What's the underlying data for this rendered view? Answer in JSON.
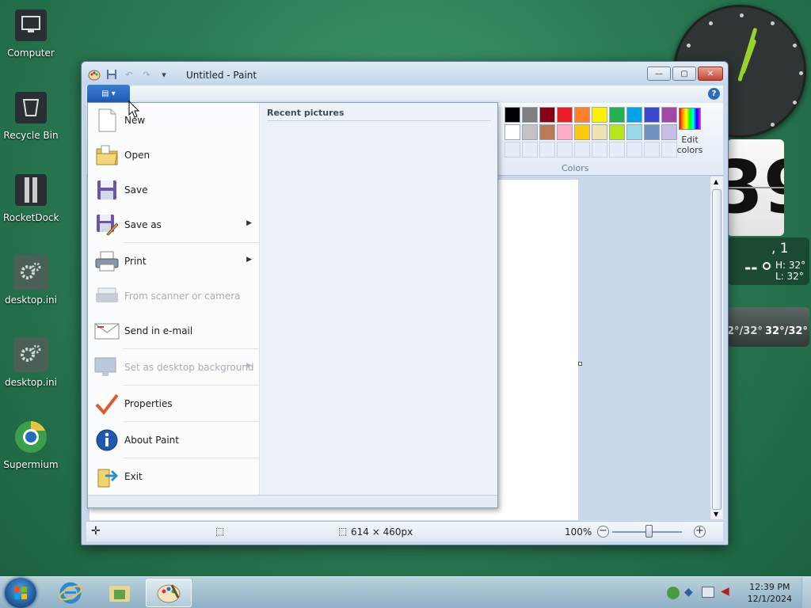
{
  "desktop": {
    "icons": [
      {
        "label": "Computer",
        "icon": "computer-icon"
      },
      {
        "label": "Recycle Bin",
        "icon": "recycle-bin-icon"
      },
      {
        "label": "RocketDock",
        "icon": "rocketdock-icon"
      },
      {
        "label": "desktop.ini",
        "icon": "settings-file-icon"
      },
      {
        "label": "desktop.ini",
        "icon": "settings-file-icon"
      },
      {
        "label": "Supermium",
        "icon": "browser-icon"
      }
    ]
  },
  "gadgets": {
    "flip_clock_digit": "39",
    "weather": {
      "top": ", 1",
      "temp": "--",
      "high": "H: 32°",
      "low": "L: 32°"
    },
    "forecast": {
      "left": "2°/32°",
      "right": "32°/32°"
    }
  },
  "window": {
    "title": "Untitled - Paint",
    "help_label": "?",
    "caption_buttons": {
      "minimize": "—",
      "maximize": "▢",
      "close": "✕"
    }
  },
  "ribbon": {
    "palette": {
      "row1": [
        "#000000",
        "#7f7f7f",
        "#880015",
        "#ed1c24",
        "#ff7f27",
        "#fff200",
        "#22b14c",
        "#00a2e8",
        "#3f48cc",
        "#a349a4"
      ],
      "row2": [
        "#ffffff",
        "#c3c3c3",
        "#b97a57",
        "#ffaec9",
        "#ffc90e",
        "#efe4b0",
        "#b5e61d",
        "#99d9ea",
        "#7092be",
        "#c8bfe7"
      ],
      "row3_empty_count": 10
    },
    "edit_colors_label": "Edit colors",
    "colors_group_label": "Colors"
  },
  "app_menu": {
    "button_glyph": "▤ ▾",
    "recent_title": "Recent pictures",
    "items": [
      {
        "label": "New",
        "icon": "new-file-icon",
        "disabled": false,
        "submenu": false
      },
      {
        "label": "Open",
        "icon": "open-folder-icon",
        "disabled": false,
        "submenu": false
      },
      {
        "label": "Save",
        "icon": "save-disk-icon",
        "disabled": false,
        "submenu": false
      },
      {
        "label": "Save as",
        "icon": "save-as-icon",
        "disabled": false,
        "submenu": true
      },
      {
        "label": "Print",
        "icon": "printer-icon",
        "disabled": false,
        "submenu": true
      },
      {
        "label": "From scanner or camera",
        "icon": "scanner-icon",
        "disabled": true,
        "submenu": false
      },
      {
        "label": "Send in e-mail",
        "icon": "email-icon",
        "disabled": false,
        "submenu": false
      },
      {
        "label": "Set as desktop background",
        "icon": "desktop-background-icon",
        "disabled": true,
        "submenu": true
      },
      {
        "label": "Properties",
        "icon": "checkmark-icon",
        "disabled": false,
        "submenu": false
      },
      {
        "label": "About Paint",
        "icon": "info-icon",
        "disabled": false,
        "submenu": false
      },
      {
        "label": "Exit",
        "icon": "exit-icon",
        "disabled": false,
        "submenu": false
      }
    ]
  },
  "statusbar": {
    "image_size": "614 × 460px",
    "zoom_label": "100%",
    "zoom_out": "−",
    "zoom_in": "+",
    "zoom_level": 1.0
  },
  "taskbar": {
    "time": "12:39 PM",
    "date": "12/1/2024"
  }
}
